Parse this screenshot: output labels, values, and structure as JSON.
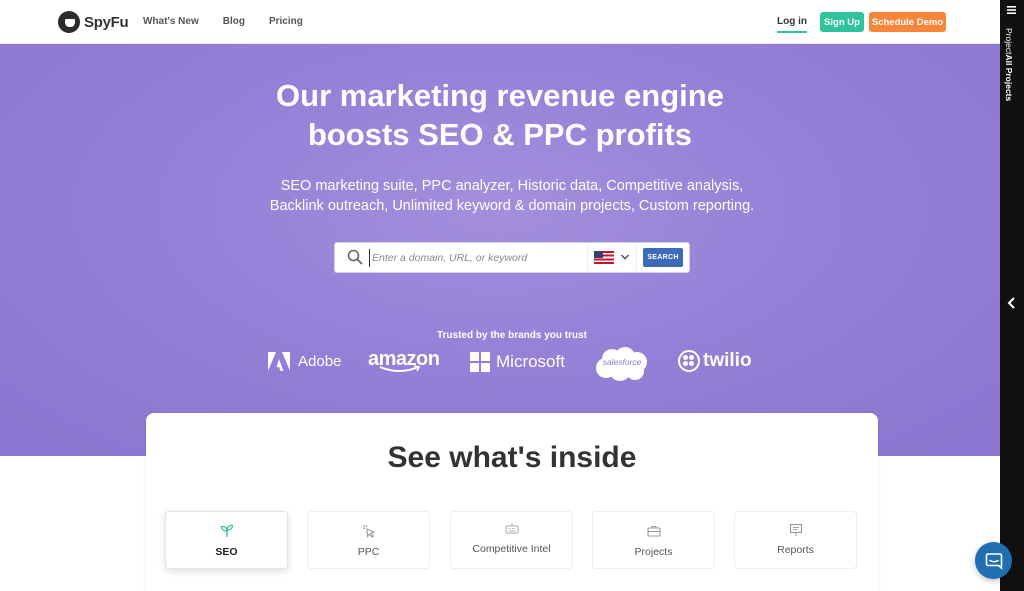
{
  "header": {
    "logo_text": "SpyFu",
    "nav": [
      {
        "label": "What's New"
      },
      {
        "label": "Blog"
      },
      {
        "label": "Pricing"
      }
    ],
    "login_label": "Log in",
    "signup_label": "Sign Up",
    "demo_label": "Schedule Demo"
  },
  "hero": {
    "headline_line1": "Our marketing revenue engine",
    "headline_line2": "boosts SEO & PPC profits",
    "sub_line1": "SEO marketing suite, PPC analyzer, Historic data, Competitive analysis,",
    "sub_line2": "Backlink outreach, Unlimited keyword & domain projects, Custom reporting.",
    "search": {
      "placeholder": "Enter a domain, URL, or keyword",
      "value": "",
      "country_icon": "us-flag-icon",
      "button_label": "SEARCH"
    },
    "trusted_label": "Trusted by the brands you trust",
    "brands": {
      "adobe": "Adobe",
      "amazon": "amazon",
      "microsoft": "Microsoft",
      "salesforce": "salesforce",
      "twilio": "twilio"
    }
  },
  "inside": {
    "title": "See what's inside",
    "tiles": [
      {
        "label": "SEO",
        "icon": "sprout-icon",
        "active": true
      },
      {
        "label": "PPC",
        "icon": "cursor-click-icon",
        "active": false
      },
      {
        "label": "Competitive Intel",
        "icon": "keyboard-icon",
        "active": false
      },
      {
        "label": "Projects",
        "icon": "briefcase-icon",
        "active": false
      },
      {
        "label": "Reports",
        "icon": "presentation-icon",
        "active": false
      }
    ]
  },
  "sidebar": {
    "prefix": "Project",
    "title": "All Projects"
  },
  "colors": {
    "hero_purple": "#9480d6",
    "signup_green": "#2fc39b",
    "demo_orange": "#f7853a",
    "search_blue": "#3d6bb9",
    "seo_icon_green": "#2fc39b",
    "chat_blue": "#1f6fb2"
  }
}
